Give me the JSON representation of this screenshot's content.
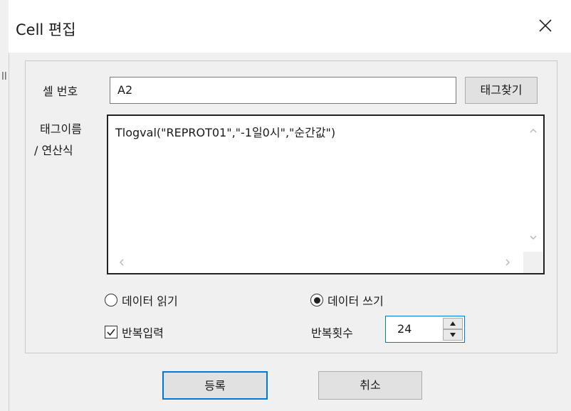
{
  "dialog": {
    "title": "Cell 편집",
    "close_label": "×"
  },
  "cell": {
    "label": "셀 번호",
    "value": "A2",
    "find_tag_label": "태그찾기"
  },
  "formula": {
    "label_line1": "태그이름",
    "label_line2": "/ 연산식",
    "value": "Tlogval(\"REPROT01\",\"-1일0시\",\"순간값\")"
  },
  "options": {
    "read_label": "데이터 읽기",
    "read_selected": false,
    "write_label": "데이터 쓰기",
    "write_selected": true,
    "repeat_input_label": "반복입력",
    "repeat_input_checked": true,
    "repeat_count_label": "반복횟수",
    "repeat_count_value": "24"
  },
  "buttons": {
    "register_label": "등록",
    "cancel_label": "취소"
  },
  "left_window_mark": "ll"
}
